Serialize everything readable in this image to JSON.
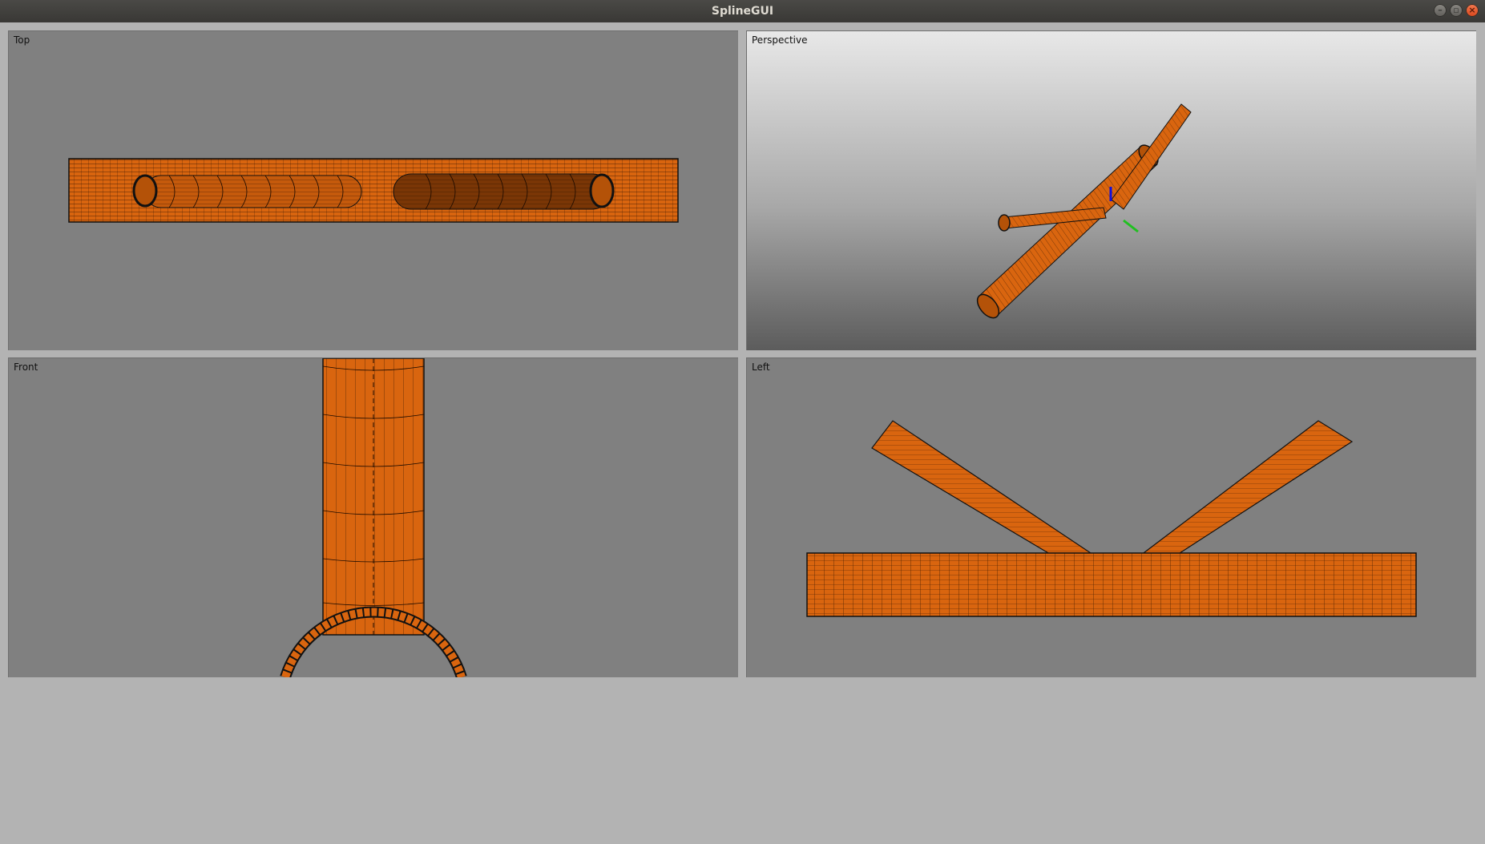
{
  "window": {
    "title": "SplineGUI",
    "controls": [
      "minimize",
      "maximize",
      "close"
    ]
  },
  "viewports": {
    "top": {
      "label": "Top"
    },
    "perspective": {
      "label": "Perspective"
    },
    "front": {
      "label": "Front"
    },
    "left": {
      "label": "Left"
    }
  },
  "colors": {
    "pipe": "#d9650f",
    "pipe_dark": "#8a3c05",
    "wire": "#1a0a00",
    "viewport_bg": "#808080",
    "window_bg": "#b3b3b3",
    "axis_z": "#1010e0",
    "axis_y": "#20c020"
  }
}
